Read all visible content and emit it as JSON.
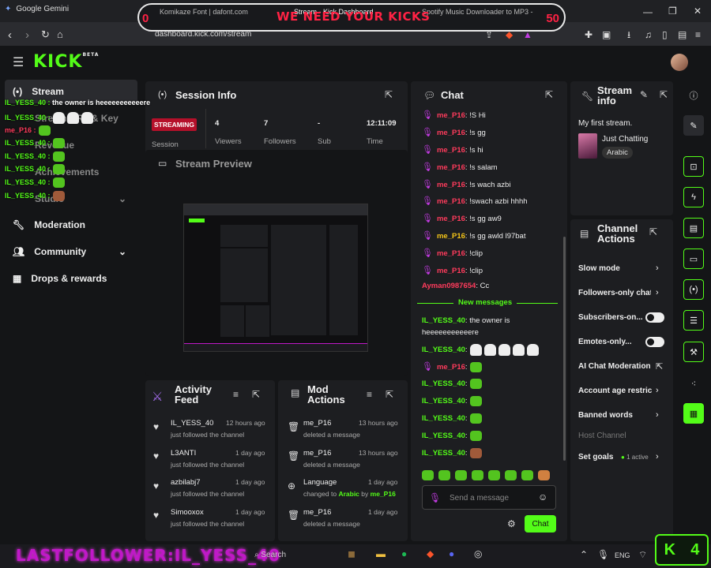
{
  "browser": {
    "gemini_tab": "Google Gemini",
    "tabs": [
      "Komikaze Font | dafont.com",
      "Stream - Kick Dashboard",
      "Spotify Music Downloader to MP3 -"
    ],
    "overlay_banner": "WE NEED YOUR KICKS",
    "counter_left": "0",
    "counter_right": "50",
    "url": "dashboard.kick.com/stream"
  },
  "app": {
    "logo": "KICK",
    "logo_badge": "BETA"
  },
  "sidebar": {
    "items": [
      {
        "label": "Stream",
        "icon": "broadcast-icon"
      },
      {
        "label": "Stream URL & Key"
      },
      {
        "label": "Revenue"
      },
      {
        "label": "Achievements"
      },
      {
        "label": "Studio"
      },
      {
        "label": "Moderation",
        "icon": "wrench-icon"
      },
      {
        "label": "Community",
        "icon": "community-icon"
      },
      {
        "label": "Drops & rewards",
        "icon": "gift-icon"
      }
    ]
  },
  "overlay_chat": [
    {
      "user": "IL_YESS_40",
      "msg": "the owner is heeeeeeeeeeere"
    },
    {
      "user": "IL_YESS_40",
      "msg": ""
    },
    {
      "user": "me_P16",
      "msg": ""
    },
    {
      "user": "IL_YESS_40",
      "msg": ""
    },
    {
      "user": "IL_YESS_40",
      "msg": ""
    },
    {
      "user": "IL_YESS_40",
      "msg": ""
    },
    {
      "user": "IL_YESS_40",
      "msg": ""
    },
    {
      "user": "IL_YESS_40",
      "msg": ""
    }
  ],
  "session": {
    "title": "Session Info",
    "status": "STREAMING",
    "status_label": "Session",
    "stats": [
      {
        "value": "4",
        "label": "Viewers"
      },
      {
        "value": "7",
        "label": "Followers"
      },
      {
        "value": "-",
        "label": "Sub"
      },
      {
        "value": "12:11:09",
        "label": "Time"
      }
    ]
  },
  "preview": {
    "title": "Stream Preview"
  },
  "activity": {
    "title_1": "Activity",
    "title_2": "Feed",
    "items": [
      {
        "name": "IL_YESS_40",
        "time": "12 hours ago",
        "desc": "just followed the channel"
      },
      {
        "name": "L3ANTI",
        "time": "1 day ago",
        "desc": "just followed the channel"
      },
      {
        "name": "azbilabj7",
        "time": "1 day ago",
        "desc": "just followed the channel"
      },
      {
        "name": "Simooxox",
        "time": "1 day ago",
        "desc": "just followed the channel"
      }
    ]
  },
  "mod": {
    "title_1": "Mod",
    "title_2": "Actions",
    "items": [
      {
        "name": "me_P16",
        "time": "13 hours ago",
        "desc": "deleted a message"
      },
      {
        "name": "me_P16",
        "time": "13 hours ago",
        "desc": "deleted a message"
      },
      {
        "name": "Language",
        "time": "1 day ago",
        "desc_pre": "changed to",
        "lang": "Arabic",
        "by": "by",
        "user": "me_P16"
      },
      {
        "name": "me_P16",
        "time": "1 day ago",
        "desc": "deleted a message"
      }
    ]
  },
  "chat": {
    "title": "Chat",
    "messages": [
      {
        "user": "me_P16",
        "msg": ": !S Hi"
      },
      {
        "user": "me_P16",
        "msg": ": !s gg"
      },
      {
        "user": "me_P16",
        "msg": ": !s hi"
      },
      {
        "user": "me_P16",
        "msg": ": !s salam"
      },
      {
        "user": "me_P16",
        "msg": ": !s wach azbi"
      },
      {
        "user": "me_P16",
        "msg": ": !swach azbi hhhh"
      },
      {
        "user": "me_P16",
        "msg": ": !s gg aw9"
      },
      {
        "user": "me_P16",
        "msg": ": !s gg awld l97bat"
      },
      {
        "user": "me_P16",
        "msg": ": !clip"
      },
      {
        "user": "me_P16",
        "msg": ": !clip"
      }
    ],
    "ayman": {
      "user": "Ayman0987654",
      "msg": ": Cc"
    },
    "divider": "New messages",
    "new_messages": [
      {
        "user": "IL_YESS_40",
        "msg": ": the owner is"
      },
      {
        "user": "",
        "msg": "heeeeeeeeeeere"
      },
      {
        "user": "IL_YESS_40",
        "msg": ":"
      },
      {
        "user": "me_P16",
        "msg": ":"
      },
      {
        "user": "IL_YESS_40",
        "msg": ":"
      },
      {
        "user": "IL_YESS_40",
        "msg": ":"
      },
      {
        "user": "IL_YESS_40",
        "msg": ":"
      },
      {
        "user": "IL_YESS_40",
        "msg": ":"
      },
      {
        "user": "IL_YESS_40",
        "msg": ":"
      }
    ],
    "placeholder": "Send a message",
    "send_label": "Chat"
  },
  "stream_info": {
    "title_1": "Stream",
    "title_2": "info",
    "stream_title": "My first stream.",
    "category": "Just Chatting",
    "language": "Arabic"
  },
  "channel_actions": {
    "title_1": "Channel",
    "title_2": "Actions",
    "items": [
      {
        "label": "Slow mode",
        "type": "chevron"
      },
      {
        "label": "Followers-only chat",
        "type": "chevron"
      },
      {
        "label": "Subscribers-on...",
        "type": "toggle"
      },
      {
        "label": "Emotes-only...",
        "type": "toggle"
      },
      {
        "label": "AI Chat Moderation",
        "type": "external"
      },
      {
        "label": "Account age restric",
        "type": "chevron"
      },
      {
        "label": "Banned words",
        "type": "chevron"
      },
      {
        "label": "Host Channel",
        "type": "disabled"
      },
      {
        "label": "Set goals",
        "type": "chevron",
        "badge": "1 active"
      }
    ]
  },
  "taskbar": {
    "last_follower": "LASTFOLLOWER:IL_YESS_40",
    "search": "Search",
    "lang": "ENG",
    "kick_count": "4"
  },
  "colors": {
    "accent": "#53fc18",
    "user_pink": "#c13be0",
    "user_red": "#ff3b5c"
  }
}
